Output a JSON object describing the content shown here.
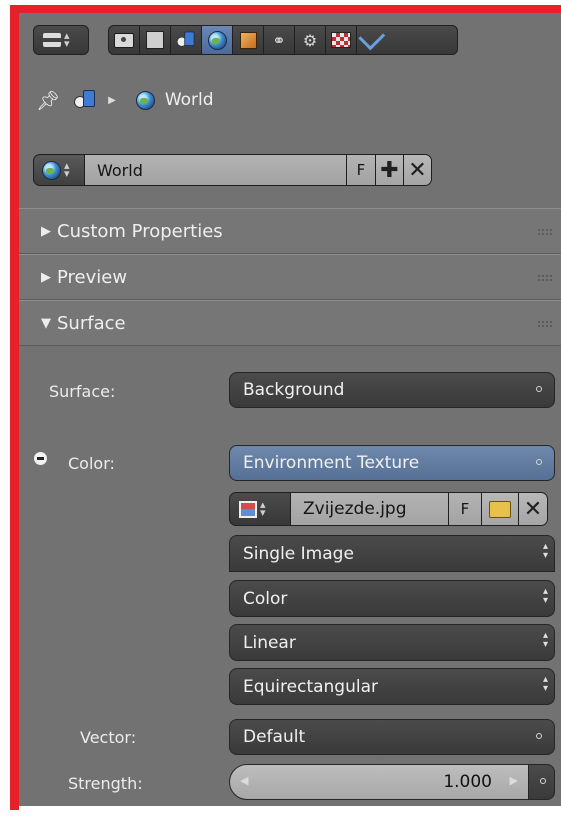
{
  "toolbar": {
    "editor_type_icon": "menu-icon",
    "context_tabs": [
      "render-icon",
      "render-layers-icon",
      "scene-icon",
      "world-icon",
      "object-icon",
      "constraints-icon",
      "modifiers-icon",
      "texture-icon",
      "physics-icon"
    ],
    "active_tab": "world-icon"
  },
  "breadcrumb": {
    "pin_icon": "pin-icon",
    "scene_icon": "scene-icon",
    "label": "World"
  },
  "world_datablock": {
    "name": "World",
    "fake_user_label": "F",
    "add_glyph": "✚",
    "remove_glyph": "✕"
  },
  "panels": {
    "custom_properties": {
      "label": "Custom Properties",
      "collapsed_glyph": "▶"
    },
    "preview": {
      "label": "Preview",
      "collapsed_glyph": "▶"
    },
    "surface": {
      "label": "Surface",
      "expanded_glyph": "▼"
    }
  },
  "surface": {
    "surface_label": "Surface:",
    "surface_value": "Background",
    "color_label": "Color:",
    "color_value": "Environment Texture",
    "image": {
      "name": "Zvijezde.jpg",
      "fake_user_label": "F",
      "remove_glyph": "✕"
    },
    "dropdowns": {
      "source": "Single Image",
      "color_space": "Color",
      "interpolation": "Linear",
      "projection": "Equirectangular"
    },
    "vector_label": "Vector:",
    "vector_value": "Default",
    "strength_label": "Strength:",
    "strength_value": "1.000"
  },
  "colors": {
    "frame_red": "#e8202a",
    "panel_bg": "#727272",
    "active_blue": "#5c78a4"
  }
}
